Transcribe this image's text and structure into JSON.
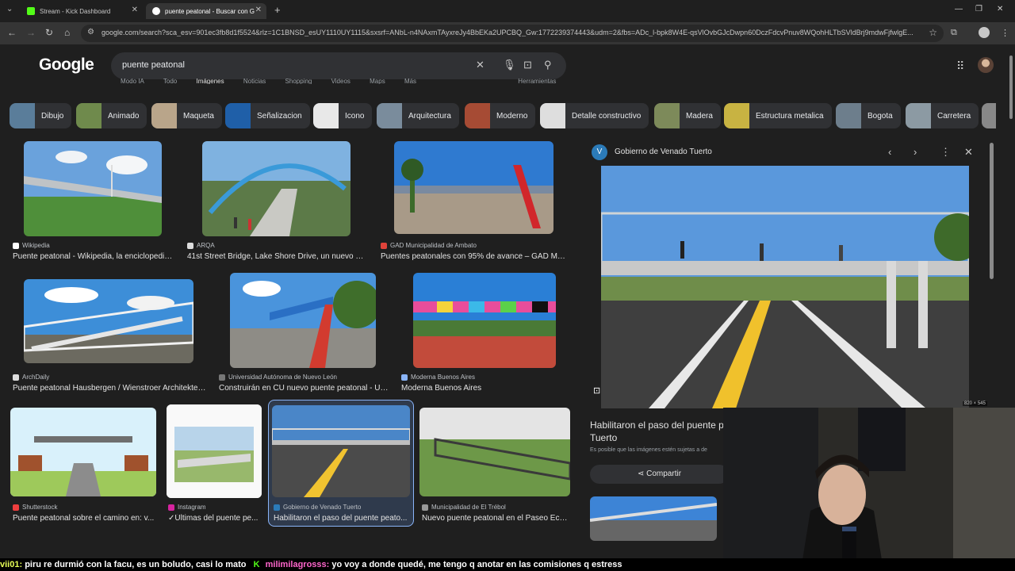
{
  "browser": {
    "tabs": [
      {
        "label": "Stream - Kick Dashboard",
        "favicon_color": "#53fc18"
      },
      {
        "label": "puente peatonal - Buscar con G",
        "favicon_color": "#4285f4"
      }
    ],
    "new_tab_label": "+",
    "url": "google.com/search?sca_esv=901ec3fb8d1f5524&rlz=1C1BNSD_esUY1110UY1115&sxsrf=ANbL-n4NAxmTAyxreJy4BbEKa2UPCBQ_Gw:1772239374443&udm=2&fbs=ADc_l-bpk8W4E-qsVlOvbGJcDwpn60DczFdcvPnuv8WQohHLTbSVldBrj9mdwFjfwlgE..."
  },
  "google": {
    "logo": "Google",
    "query": "puente peatonal",
    "subnav": [
      "Modo IA",
      "Todo",
      "Imágenes",
      "Noticias",
      "Shopping",
      "Videos",
      "Maps",
      "Más",
      "Herramientas"
    ]
  },
  "chips": [
    {
      "label": "Dibujo",
      "color": "#5a7d9a"
    },
    {
      "label": "Animado",
      "color": "#6f8a4c"
    },
    {
      "label": "Maqueta",
      "color": "#b9a58a"
    },
    {
      "label": "Señalizacion",
      "color": "#1f5fa8"
    },
    {
      "label": "Icono",
      "color": "#e8e8e8"
    },
    {
      "label": "Arquitectura",
      "color": "#7a8c9c"
    },
    {
      "label": "Moderno",
      "color": "#a64b34"
    },
    {
      "label": "Detalle constructivo",
      "color": "#dedede"
    },
    {
      "label": "Madera",
      "color": "#7d8a5a"
    },
    {
      "label": "Estructura metalica",
      "color": "#c8b342"
    },
    {
      "label": "Bogota",
      "color": "#6d7e8c"
    },
    {
      "label": "Carretera",
      "color": "#8c9aa3"
    }
  ],
  "results": [
    {
      "source": "Wikipedia",
      "title": "Puente peatonal - Wikipedia, la enciclopedia...",
      "fav": "#ffffff"
    },
    {
      "source": "ARQA",
      "title": "41st Street Bridge, Lake Shore Drive, un nuevo pu...",
      "fav": "#dddddd"
    },
    {
      "source": "GAD Municipalidad de Ambato",
      "title": "Puentes peatonales con 95% de avance – GAD Muni...",
      "fav": "#e0433a"
    },
    {
      "source": "ArchDaily",
      "title": "Puente peatonal Hausbergen / Wienstroer Architekten...",
      "fav": "#dddddd"
    },
    {
      "source": "Universidad Autónoma de Nuevo León",
      "title": "Construirán en CU nuevo puente peatonal - Un...",
      "fav": "#777777"
    },
    {
      "source": "Moderna Buenos Aires",
      "title": "Moderna Buenos Aires",
      "fav": "#8ab4f8"
    },
    {
      "source": "Shutterstock",
      "title": "Puente peatonal sobre el camino en: v...",
      "fav": "#ee3e3e"
    },
    {
      "source": "Instagram",
      "title": "✓Últimas del puente pe...",
      "fav": "#d6249f"
    },
    {
      "source": "Gobierno de Venado Tuerto",
      "title": "Habilitaron el paso del puente peato...",
      "fav": "#2b7bb9"
    },
    {
      "source": "Municipalidad de El Trébol",
      "title": "Nuevo puente peatonal en el Paseo Ecol...",
      "fav": "#999999"
    }
  ],
  "preview": {
    "source": "Gobierno de Venado Tuerto",
    "title": "Habilitaron el paso del puente peatonal de Venado Tuerto",
    "title_visible": "Habilitaron el paso del puente p Tuerto",
    "title_line1": "Habilitaron el paso del puente p",
    "title_line2": "Tuerto",
    "note": "Es posible que las imágenes estén sujetas a de",
    "share_label": "Compartir",
    "dimensions": "820 × 545"
  },
  "ticker": {
    "user1": "vii01:",
    "msg1": "piru re durmió con la facu, es un boludo, casi lo mato",
    "user2": "milimilagrosss:",
    "msg2": "yo voy a donde quedé, me tengo q anotar en las comisiones q estress"
  }
}
